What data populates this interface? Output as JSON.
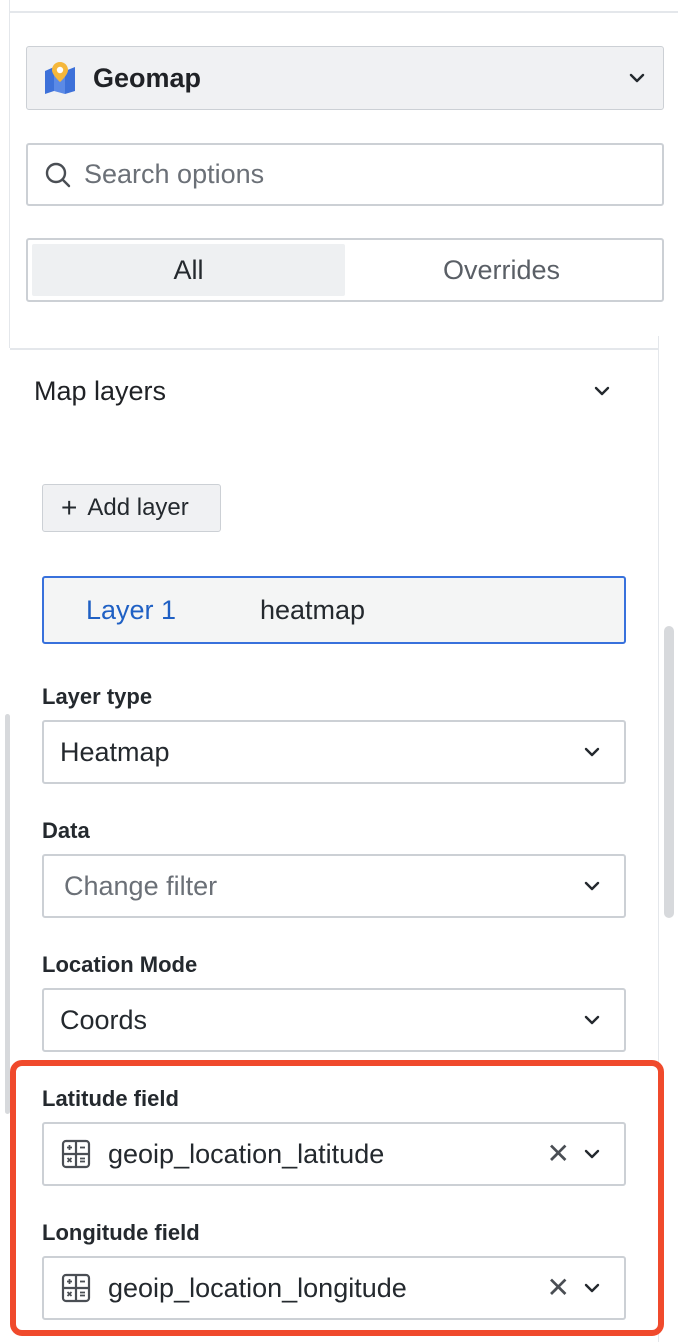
{
  "visualization": {
    "label": "Geomap",
    "icon": "map-pin-icon"
  },
  "search": {
    "placeholder": "Search options",
    "value": ""
  },
  "tabs": [
    {
      "label": "All",
      "active": true
    },
    {
      "label": "Overrides",
      "active": false
    }
  ],
  "section": {
    "title": "Map layers",
    "expanded": true
  },
  "add_layer": {
    "label": "Add layer"
  },
  "layer": {
    "name": "Layer 1",
    "type": "heatmap"
  },
  "fields": {
    "layer_type": {
      "label": "Layer type",
      "value": "Heatmap"
    },
    "data": {
      "label": "Data",
      "placeholder": "Change filter"
    },
    "location_mode": {
      "label": "Location Mode",
      "value": "Coords"
    },
    "latitude": {
      "label": "Latitude field",
      "value": "geoip_location_latitude"
    },
    "longitude": {
      "label": "Longitude field",
      "value": "geoip_location_longitude"
    }
  },
  "colors": {
    "accent_blue": "#3871dc",
    "highlight": "#f04a2c"
  }
}
